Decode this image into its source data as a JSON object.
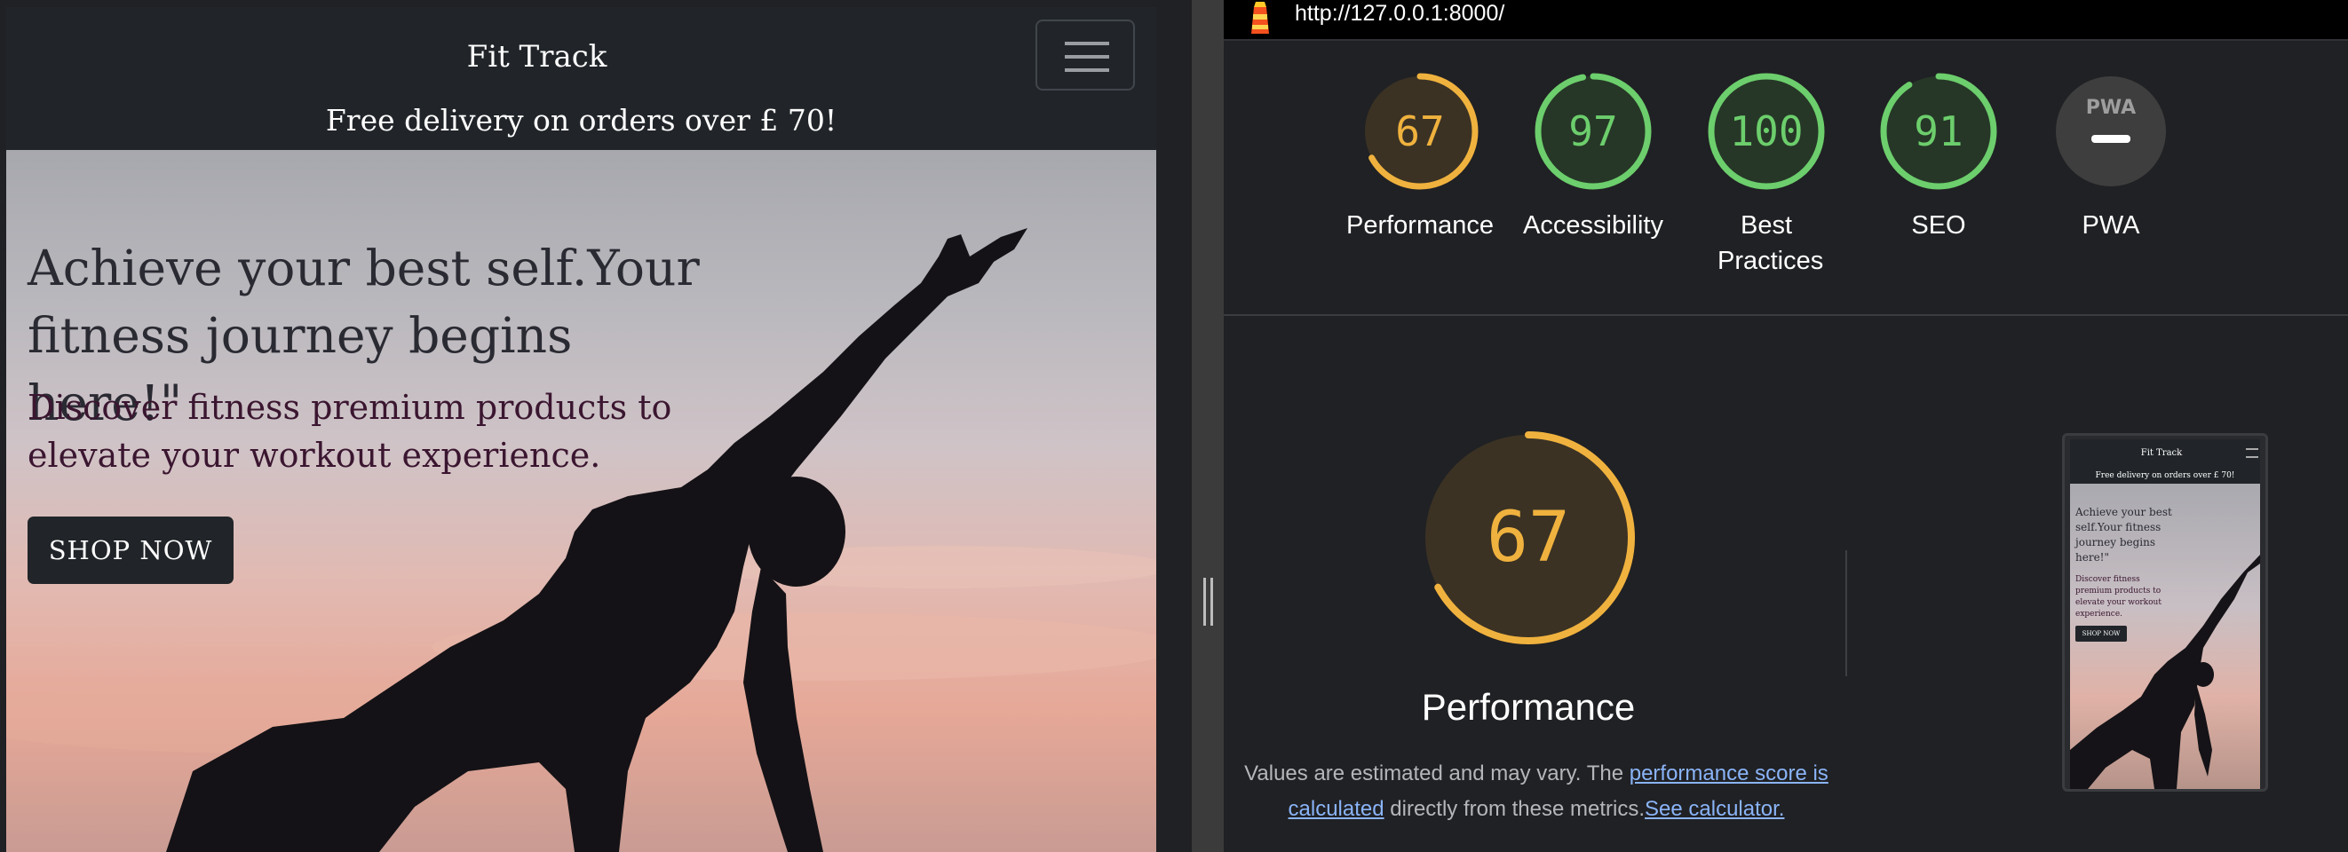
{
  "site": {
    "brand": "Fit Track",
    "banner": "Free delivery on orders over £ 70!",
    "hero_heading": "Achieve your best self.Your fitness journey begins here!\"",
    "hero_text": "Discover fitness premium products to elevate your workout experience.",
    "cta_label": "SHOP NOW"
  },
  "lighthouse": {
    "url": "http://127.0.0.1:8000/",
    "scores": [
      {
        "label": "Performance",
        "value": "67",
        "score": 0.67,
        "color": "#f0b23e",
        "fill": "#3b3224"
      },
      {
        "label": "Accessibility",
        "value": "97",
        "score": 0.97,
        "color": "#6cce6c",
        "fill": "#263727"
      },
      {
        "label": "Best Practices",
        "value": "100",
        "score": 1.0,
        "color": "#6cce6c",
        "fill": "#263727"
      },
      {
        "label": "SEO",
        "value": "91",
        "score": 0.91,
        "color": "#6cce6c",
        "fill": "#263727"
      },
      {
        "label": "PWA",
        "value": "",
        "badge": "PWA",
        "color": "#ffffff",
        "fill": "#3e3e3e"
      }
    ],
    "focus": {
      "value": "67",
      "score": 0.67,
      "title": "Performance",
      "note_before": "Values are estimated and may vary. The ",
      "note_link1": "performance score is calculated",
      "note_middle": " directly from these metrics.",
      "note_link2": "See calculator."
    },
    "thumbnail": {
      "brand": "Fit Track",
      "banner": "Free delivery on orders over £ 70!",
      "heading": "Achieve your best self.Your fitness journey begins here!\"",
      "text": "Discover fitness premium products to elevate your workout experience.",
      "cta": "SHOP NOW"
    }
  }
}
